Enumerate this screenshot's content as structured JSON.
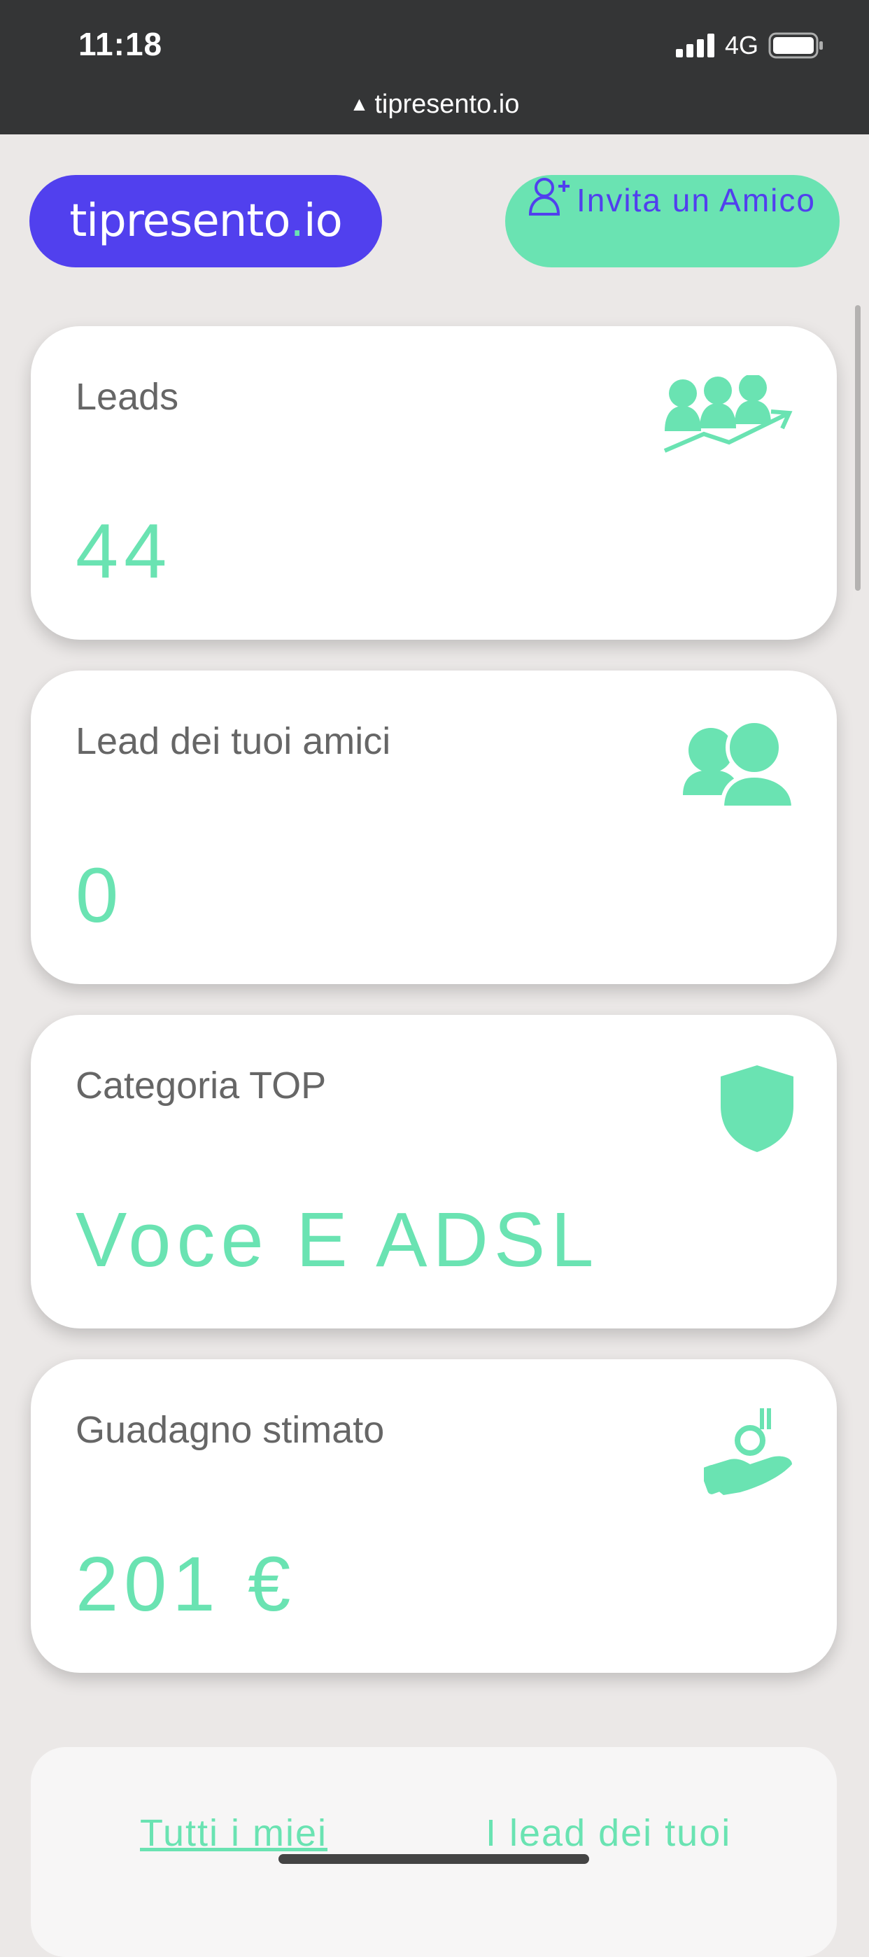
{
  "status_bar": {
    "time": "11:18",
    "network": "4G",
    "url": "tipresento.io"
  },
  "header": {
    "logo_main": "tipresento",
    "logo_dot": ".",
    "logo_tld": "io",
    "invite_label": "Invita un Amico"
  },
  "cards": [
    {
      "title": "Leads",
      "value": "44",
      "icon": "leads-growth-icon"
    },
    {
      "title": "Lead dei tuoi amici",
      "value": "0",
      "icon": "friends-icon"
    },
    {
      "title": "Categoria TOP",
      "value": "Voce E ADSL",
      "icon": "shield-icon"
    },
    {
      "title": "Guadagno stimato",
      "value": "201 €",
      "icon": "earnings-hand-icon"
    }
  ],
  "bottom_links": {
    "my_leads": "Tutti i miei",
    "friends_leads": "I lead dei tuoi"
  },
  "colors": {
    "accent_purple": "#5140ee",
    "accent_green": "#6ae3b2",
    "status_bar": "#343536",
    "background": "#ebe8e7"
  }
}
